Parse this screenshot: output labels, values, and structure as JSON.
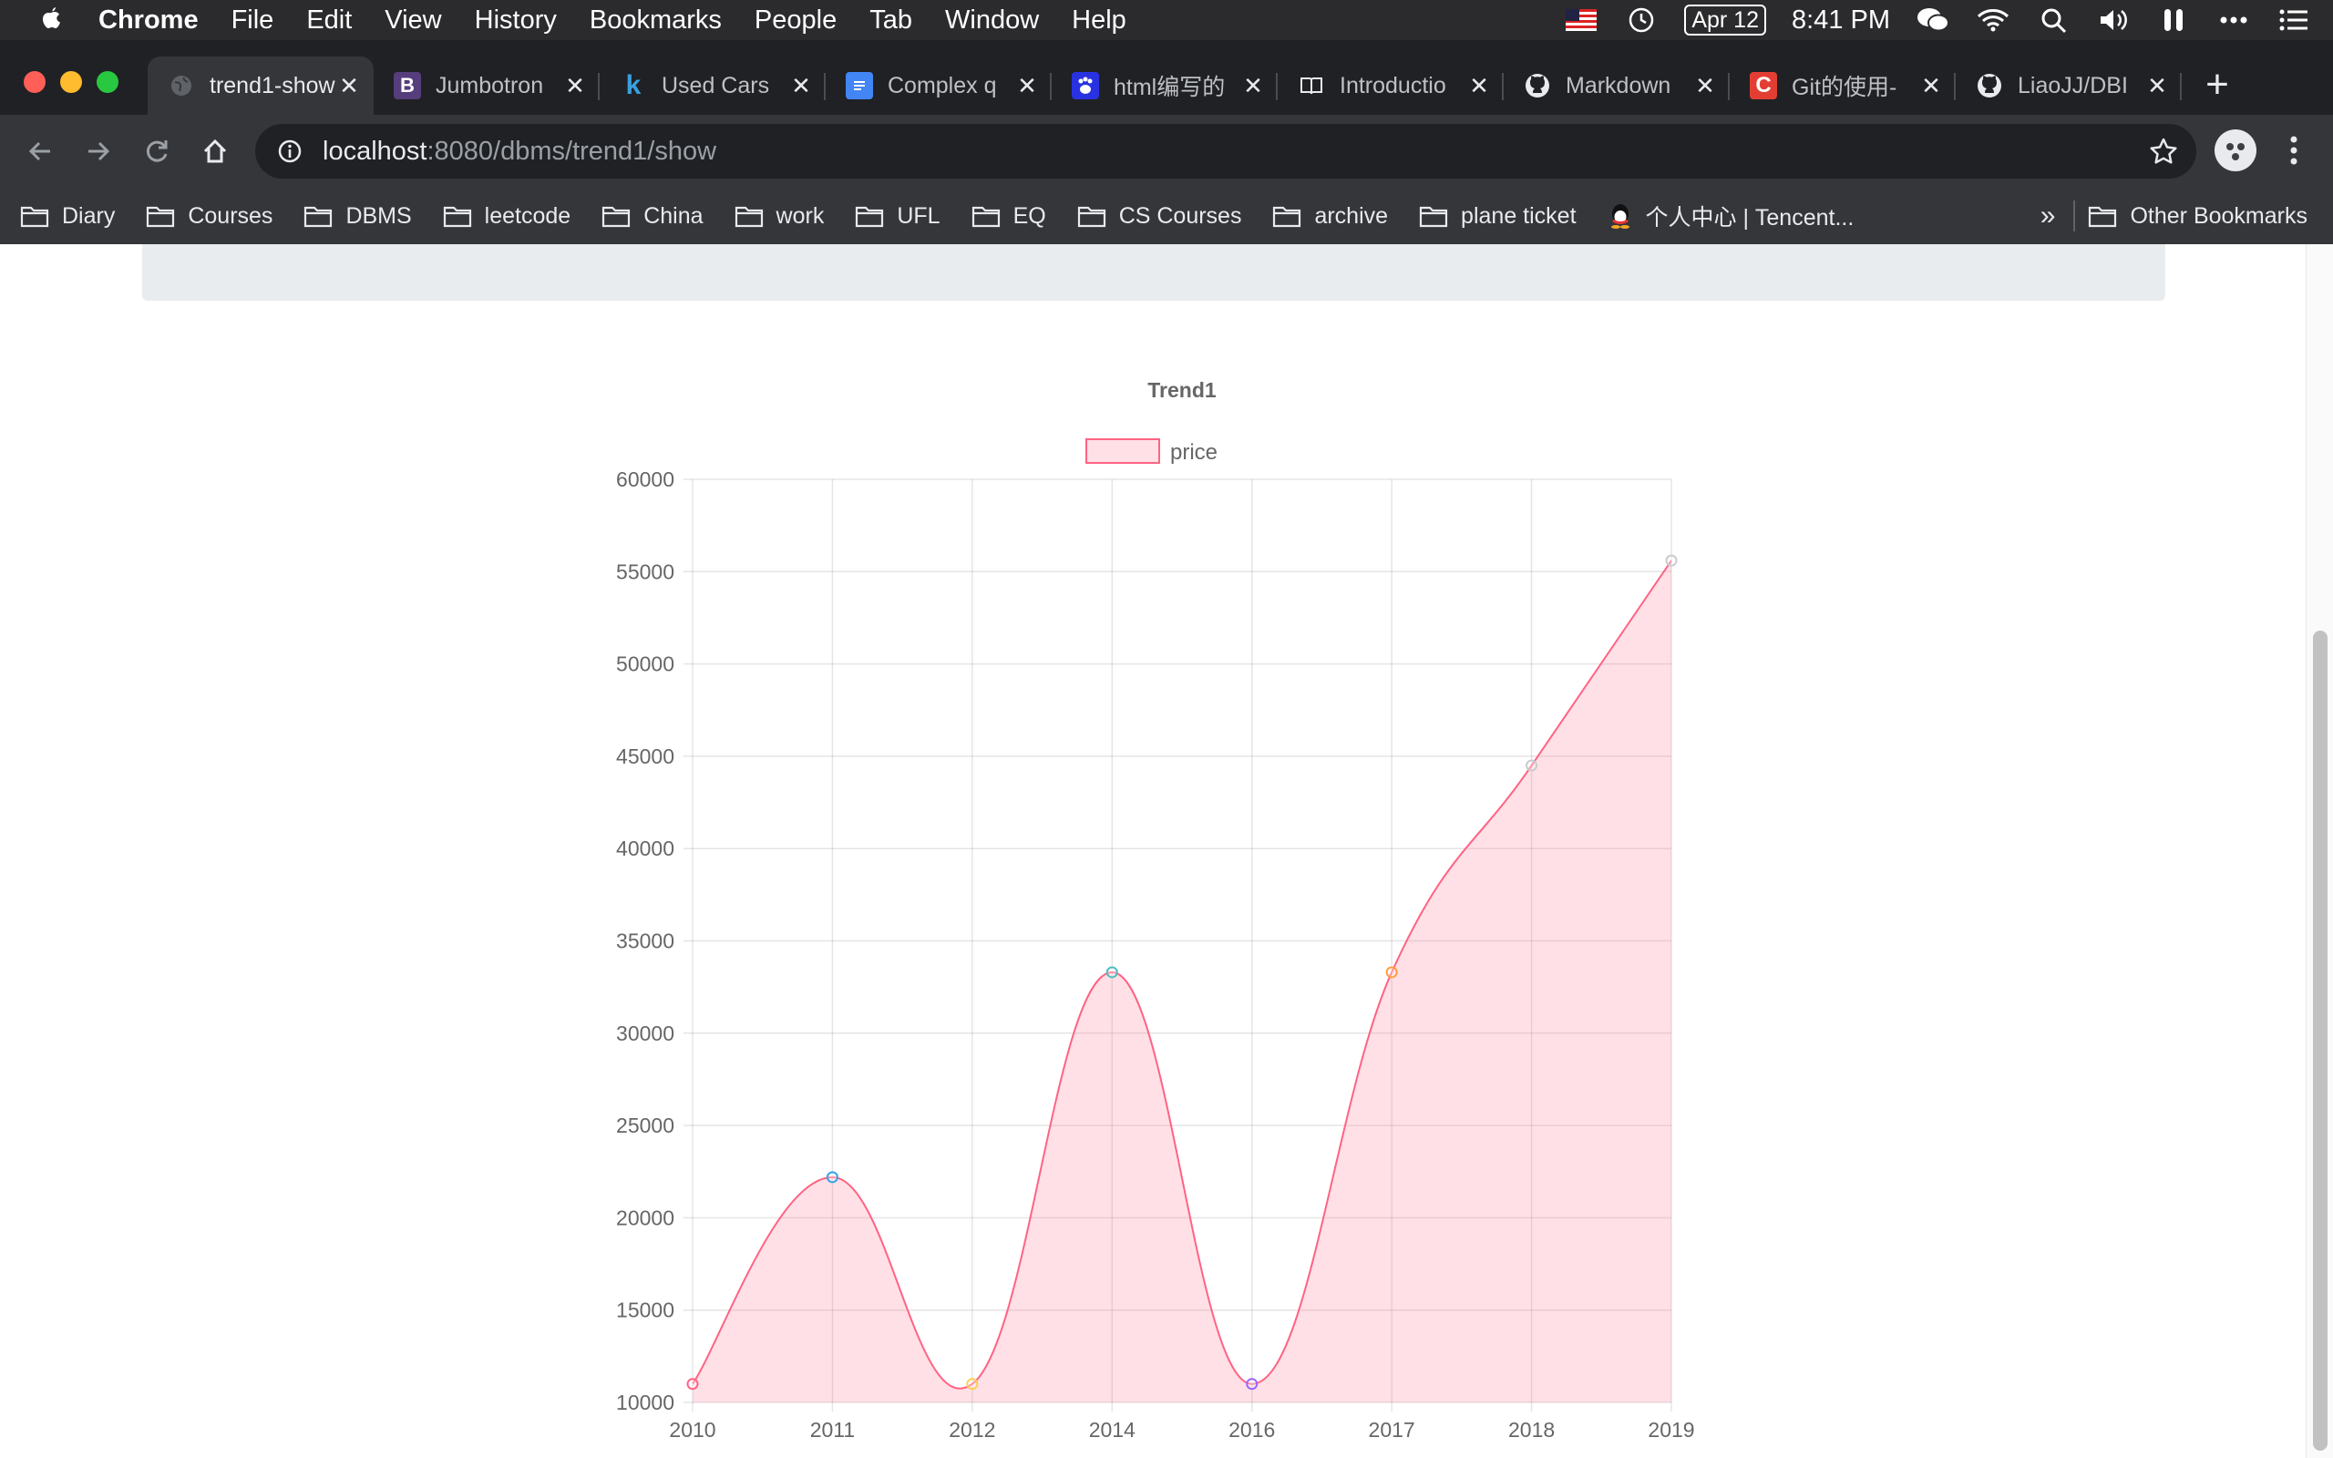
{
  "menubar": {
    "app_name": "Chrome",
    "items": [
      "File",
      "Edit",
      "View",
      "History",
      "Bookmarks",
      "People",
      "Tab",
      "Window",
      "Help"
    ],
    "date": "Apr 12",
    "time": "8:41 PM"
  },
  "tabs": [
    {
      "title": "trend1-show",
      "favicon": "globe-icon",
      "active": true
    },
    {
      "title": "Jumbotron",
      "favicon": "bootstrap-icon",
      "active": false
    },
    {
      "title": "Used Cars",
      "favicon": "k-icon",
      "active": false
    },
    {
      "title": "Complex q",
      "favicon": "docs-icon",
      "active": false
    },
    {
      "title": "html编写的",
      "favicon": "baidu-icon",
      "active": false
    },
    {
      "title": "Introductio",
      "favicon": "book-icon",
      "active": false
    },
    {
      "title": "Markdown",
      "favicon": "github-icon",
      "active": false
    },
    {
      "title": "Git的使用-",
      "favicon": "csdn-icon",
      "active": false
    },
    {
      "title": "LiaoJJ/DBI",
      "favicon": "github-icon",
      "active": false
    }
  ],
  "address_bar": {
    "host": "localhost",
    "path": ":8080/dbms/trend1/show"
  },
  "bookmarks": [
    "Diary",
    "Courses",
    "DBMS",
    "leetcode",
    "China",
    "work",
    "UFL",
    "EQ",
    "CS Courses",
    "archive",
    "plane ticket",
    "个人中心 | Tencent..."
  ],
  "bookmarks_more": "»",
  "other_bookmarks": "Other Bookmarks",
  "colors": {
    "series_line": "#ff6384",
    "series_fill": "rgba(255,99,132,0.2)",
    "point_colors": [
      "#ff6384",
      "#36a2eb",
      "#ffcd56",
      "#4bc0c0",
      "#9966ff",
      "#ff9f40",
      "#c9cbcf",
      "#c9cbcf"
    ]
  },
  "chart_data": {
    "type": "area",
    "title": "Trend1",
    "categories": [
      "2010",
      "2011",
      "2012",
      "2014",
      "2016",
      "2017",
      "2018",
      "2019"
    ],
    "series": [
      {
        "name": "price",
        "values": [
          11000,
          22200,
          11000,
          33300,
          11000,
          33300,
          44500,
          55600
        ]
      }
    ],
    "ylim": [
      10000,
      60000
    ],
    "yticks": [
      10000,
      15000,
      20000,
      25000,
      30000,
      35000,
      40000,
      45000,
      50000,
      55000,
      60000
    ],
    "legend": "top",
    "grid": true
  }
}
